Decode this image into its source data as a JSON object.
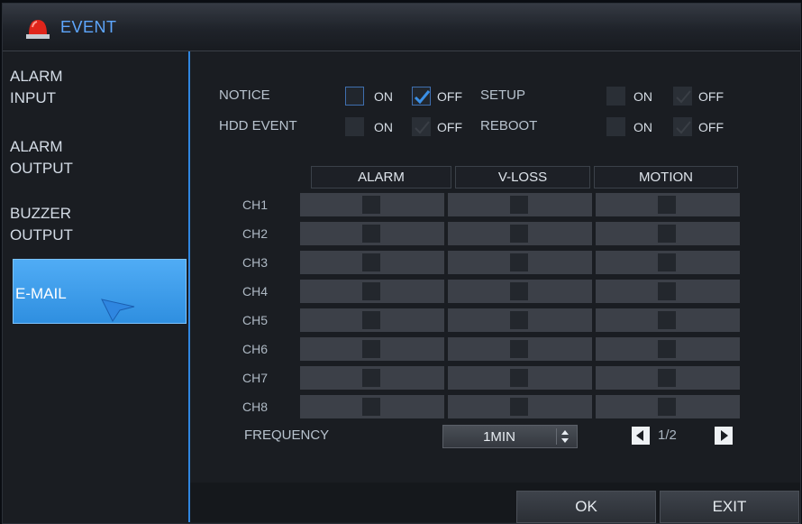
{
  "window": {
    "title": "EVENT"
  },
  "sidebar": {
    "items": [
      {
        "line1": "ALARM",
        "line2": "INPUT"
      },
      {
        "line1": "ALARM",
        "line2": "OUTPUT"
      },
      {
        "line1": "BUZZER",
        "line2": "OUTPUT"
      },
      {
        "line1": "E-MAIL",
        "line2": ""
      }
    ],
    "active_index": 3
  },
  "settings": {
    "notice": {
      "label": "NOTICE",
      "on": "ON",
      "off": "OFF",
      "selected": "OFF"
    },
    "setup": {
      "label": "SETUP",
      "on": "ON",
      "off": "OFF",
      "selected": "OFF"
    },
    "hdd_event": {
      "label": "HDD EVENT",
      "on": "ON",
      "off": "OFF",
      "selected": "OFF"
    },
    "reboot": {
      "label": "REBOOT",
      "on": "ON",
      "off": "OFF",
      "selected": "OFF"
    }
  },
  "table": {
    "columns": [
      "ALARM",
      "V-LOSS",
      "MOTION"
    ],
    "rows": [
      "CH1",
      "CH2",
      "CH3",
      "CH4",
      "CH5",
      "CH6",
      "CH7",
      "CH8"
    ]
  },
  "frequency": {
    "label": "FREQUENCY",
    "value": "1MIN"
  },
  "pagination": {
    "text": "1/2"
  },
  "footer": {
    "ok": "OK",
    "exit": "EXIT"
  },
  "colors": {
    "accent": "#2f86e0",
    "active_item": "#46a3ef",
    "title_text": "#5ea7ff",
    "alarm_icon": "#e0251b"
  }
}
